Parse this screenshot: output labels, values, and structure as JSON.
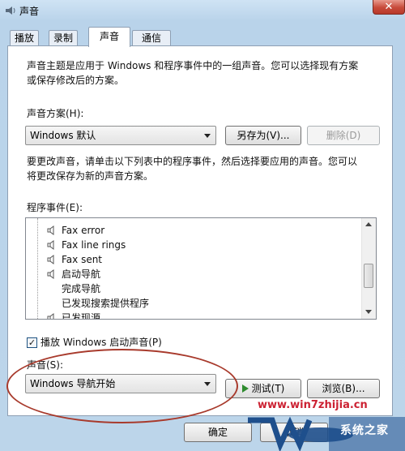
{
  "window": {
    "title": "声音",
    "close_glyph": "✕"
  },
  "tabs": [
    {
      "label": "播放"
    },
    {
      "label": "录制"
    },
    {
      "label": "声音"
    },
    {
      "label": "通信"
    }
  ],
  "sounds": {
    "intro_line1": "声音主题是应用于 Windows 和程序事件中的一组声音。您可以选择现有方案",
    "intro_line2": "或保存修改后的方案。",
    "scheme_label": "声音方案(H):",
    "scheme_value": "Windows 默认",
    "save_as_label": "另存为(V)...",
    "delete_label": "删除(D)",
    "change_line1": "要更改声音，请单击以下列表中的程序事件，然后选择要应用的声音。您可以",
    "change_line2": "将更改保存为新的声音方案。",
    "events_label": "程序事件(E):",
    "events": [
      {
        "label": "Fax error",
        "has_sound": true
      },
      {
        "label": "Fax line rings",
        "has_sound": true
      },
      {
        "label": "Fax sent",
        "has_sound": true
      },
      {
        "label": "启动导航",
        "has_sound": true
      },
      {
        "label": "完成导航",
        "has_sound": false
      },
      {
        "label": "已发现搜索提供程序",
        "has_sound": false
      },
      {
        "label": "已发现源",
        "has_sound": true
      }
    ],
    "startup_checkbox_label": "播放 Windows 启动声音(P)",
    "startup_checked": true,
    "sound_label": "声音(S):",
    "sound_value": "Windows 导航开始",
    "test_label": "测试(T)",
    "browse_label": "浏览(B)..."
  },
  "footer": {
    "ok_label": "确定",
    "cancel_label": "取消"
  },
  "watermark": {
    "url": "www.win7zhijia.cn",
    "logo_text": "系统之家"
  },
  "colors": {
    "annotation": "#a83a2c",
    "watermark": "#cc2233"
  }
}
